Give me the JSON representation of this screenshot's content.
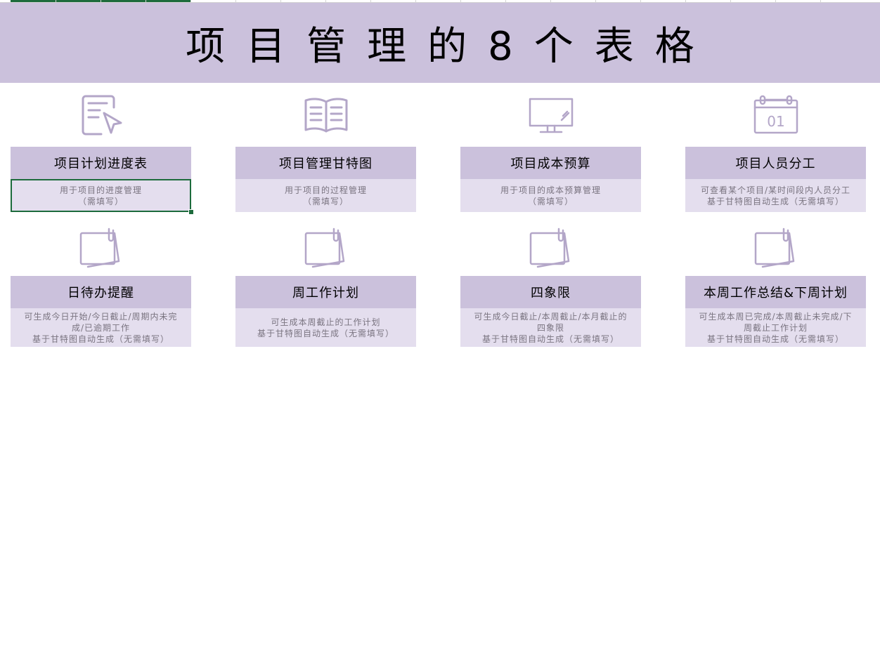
{
  "banner": {
    "title": "项目管理的8个表格"
  },
  "colors": {
    "banner_bg": "#cbc1dc",
    "card_title_bg": "#cbc1dc",
    "card_desc_bg": "#e4deee",
    "icon_stroke": "#b3a6c8",
    "selection": "#1d6b3c"
  },
  "cards": [
    {
      "icon": "edit-document-icon",
      "title": "项目计划进度表",
      "desc": [
        "用于项目的进度管理",
        "（需填写）"
      ]
    },
    {
      "icon": "open-book-icon",
      "title": "项目管理甘特图",
      "desc": [
        "用于项目的过程管理",
        "（需填写）"
      ]
    },
    {
      "icon": "monitor-icon",
      "title": "项目成本预算",
      "desc": [
        "用于项目的成本预算管理",
        "（需填写）"
      ]
    },
    {
      "icon": "calendar-icon",
      "calendar_text": "01",
      "title": "项目人员分工",
      "desc": [
        "可查看某个项目/某时间段内人员分工",
        "基于甘特图自动生成（无需填写）"
      ]
    },
    {
      "icon": "notes-clip-icon",
      "title": "日待办提醒",
      "desc": [
        "可生成今日开始/今日截止/周期内未完",
        "成/已逾期工作",
        "基于甘特图自动生成（无需填写）"
      ]
    },
    {
      "icon": "notes-clip-icon",
      "title": "周工作计划",
      "desc": [
        "可生成本周截止的工作计划",
        "基于甘特图自动生成（无需填写）"
      ]
    },
    {
      "icon": "notes-clip-icon",
      "title": "四象限",
      "desc": [
        "可生成今日截止/本周截止/本月截止的",
        "四象限",
        "基于甘特图自动生成（无需填写）"
      ]
    },
    {
      "icon": "notes-clip-icon",
      "title": "本周工作总结&下周计划",
      "desc": [
        "可生成本周已完成/本周截止未完成/下",
        "周截止工作计划",
        "基于甘特图自动生成（无需填写）"
      ]
    }
  ]
}
